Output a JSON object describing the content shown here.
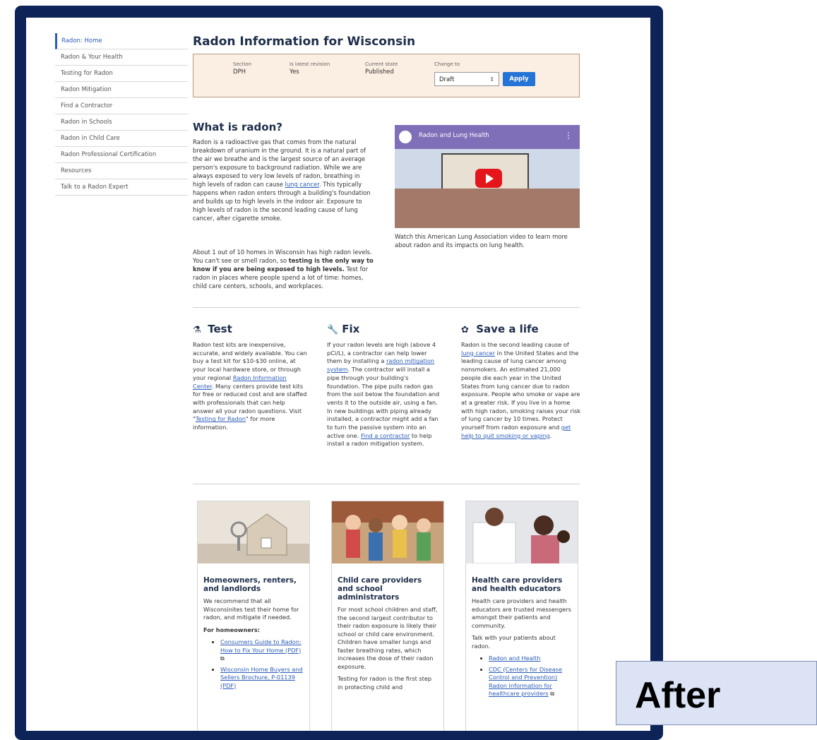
{
  "sidebar": {
    "items": [
      {
        "label": "Radon: Home"
      },
      {
        "label": "Radon & Your Health"
      },
      {
        "label": "Testing for Radon"
      },
      {
        "label": "Radon Mitigation"
      },
      {
        "label": "Find a Contractor"
      },
      {
        "label": "Radon in Schools"
      },
      {
        "label": "Radon in Child Care"
      },
      {
        "label": "Radon Professional Certification"
      },
      {
        "label": "Resources"
      },
      {
        "label": "Talk to a Radon Expert"
      }
    ]
  },
  "page": {
    "title": "Radon Information for Wisconsin"
  },
  "status": {
    "section_label": "Section",
    "section_value": "DPH",
    "latest_label": "Is latest revision",
    "latest_value": "Yes",
    "state_label": "Current state",
    "state_value": "Published",
    "change_label": "Change to",
    "change_value": "Draft",
    "apply_label": "Apply"
  },
  "intro": {
    "heading": "What is radon?",
    "p1_a": "Radon is a radioactive gas that comes from the natural breakdown of uranium in the ground. It is a natural part of the air we breathe and is the largest source of an average person's exposure to background radiation. While we are always exposed to very low levels of radon, breathing in high levels of radon can cause ",
    "p1_link": "lung cancer",
    "p1_b": ". This typically happens when radon enters through a building's foundation and builds up to high levels in the indoor air. Exposure to high levels of radon is the second leading cause of lung cancer, after cigarette smoke.",
    "p2_a": "About 1 out of 10 homes in Wisconsin has high radon levels. You can't see or smell radon, so ",
    "p2_bold": "testing is the only way to know if you are being exposed to high levels.",
    "p2_b": " Test for radon in places where people spend a lot of time: homes, child care centers, schools, and workplaces."
  },
  "video": {
    "title": "Radon and Lung Health",
    "caption": "Watch this American Lung Association video to learn more about radon and its impacts on lung health."
  },
  "columns": {
    "test": {
      "heading": "Test",
      "t1": "Radon test kits are inexpensive, accurate, and widely available. You can buy a test kit for $10-$30 online, at your local hardware store, or through your regional ",
      "l1": "Radon Information Center",
      "t2": ". Many centers provide test kits for free or reduced cost and are staffed with professionals that can help answer all your radon questions. Visit \"",
      "l2": "Testing for Radon",
      "t3": "\" for more information."
    },
    "fix": {
      "heading": "Fix",
      "t1": "If your radon levels are high (above 4 pCi/L), a contractor can help lower them by installing a ",
      "l1": "radon mitigation system",
      "t2": ". The contractor will install a pipe through your building's foundation. The pipe pulls radon gas from the soil below the foundation and vents it to the outside air, using a fan. In new buildings with piping already installed, a contractor might add a fan to turn the passive system into an active one. ",
      "l2": "Find a contractor",
      "t3": " to help install a radon mitigation system."
    },
    "save": {
      "heading": "Save a life",
      "t1": "Radon is the second leading cause of ",
      "l1": "lung cancer",
      "t2": " in the United States and the leading cause of lung cancer among nonsmokers. An estimated 21,000 people die each year in the United States from lung cancer due to radon exposure. People who smoke or vape are at a greater risk. If you live in a home with high radon, smoking raises your risk of lung cancer by 10 times. Protect yourself from radon exposure and ",
      "l2": "get help to quit smoking or vaping",
      "t3": "."
    }
  },
  "cards": {
    "home": {
      "title": "Homeowners, renters, and landlords",
      "text": "We recommend that all Wisconsinites test their home for radon, and mitigate if needed.",
      "sub": "For homeowners:",
      "link1": "Consumers Guide to Radon: How to Fix Your Home (PDF)",
      "link2": "Wisconsin Home Buyers and Sellers Brochure, P-01139 (PDF)"
    },
    "child": {
      "title": "Child care providers and school administrators",
      "text": "For most school children and staff, the second largest contributor to their radon exposure is likely their school or child care environment. Children have smaller lungs and faster breathing rates, which increases the dose of their radon exposure.",
      "text2": "Testing for radon is the first step in protecting child and"
    },
    "health": {
      "title": "Health care providers and health educators",
      "text": "Health care providers and health educators are trusted messengers amongst their patients and community.",
      "text2": "Talk with your patients about radon.",
      "link1": "Radon and Health",
      "link2": "CDC (Centers for Disease Control and Prevention) Radon Information for healthcare providers"
    }
  },
  "badge": {
    "label": "After"
  }
}
